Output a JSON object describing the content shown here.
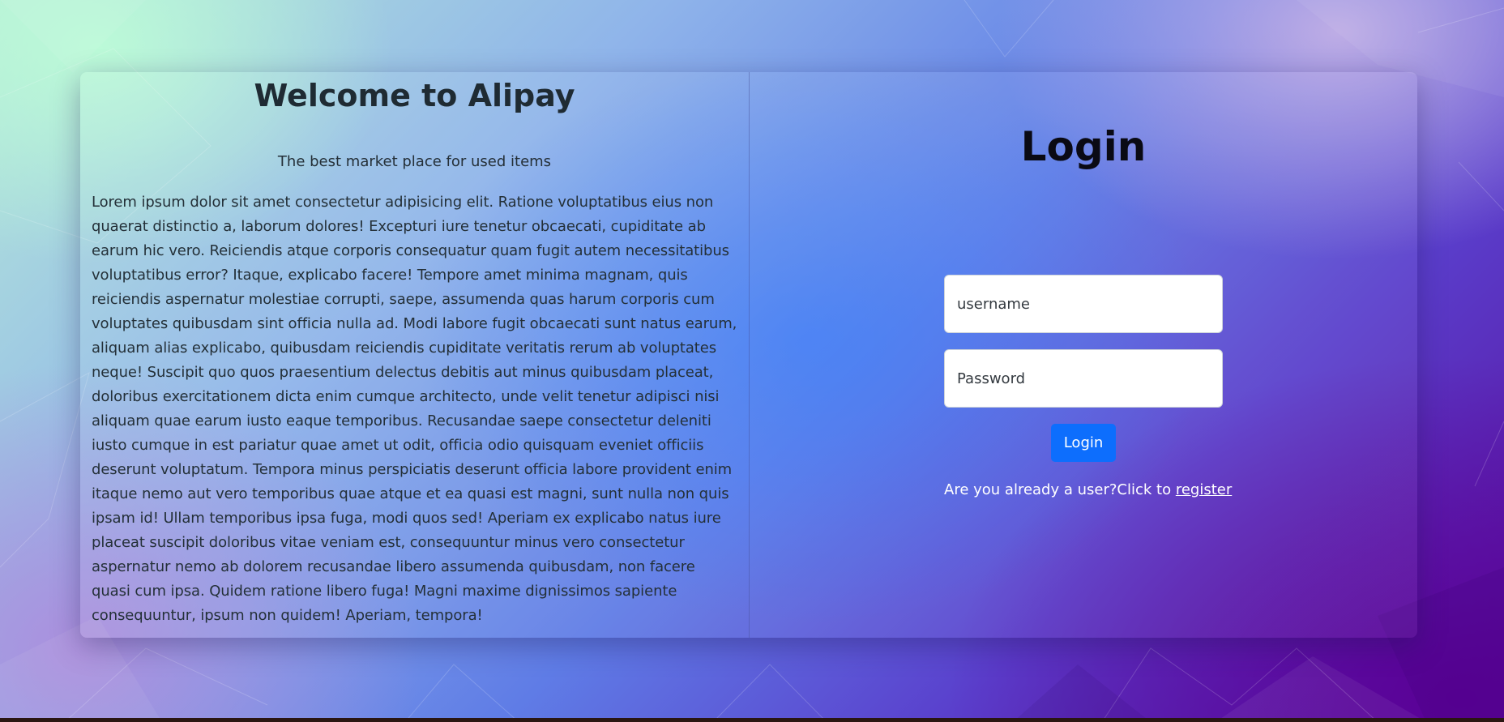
{
  "left": {
    "title": "Welcome to Alipay",
    "tagline": "The best market place for used items",
    "body": "Lorem ipsum dolor sit amet consectetur adipisicing elit. Ratione voluptatibus eius non quaerat distinctio a, laborum dolores! Excepturi iure tenetur obcaecati, cupiditate ab earum hic vero. Reiciendis atque corporis consequatur quam fugit autem necessitatibus voluptatibus error? Itaque, explicabo facere! Tempore amet minima magnam, quis reiciendis aspernatur molestiae corrupti, saepe, assumenda quas harum corporis cum voluptates quibusdam sint officia nulla ad. Modi labore fugit obcaecati sunt natus earum, aliquam alias explicabo, quibusdam reiciendis cupiditate veritatis rerum ab voluptates neque! Suscipit quo quos praesentium delectus debitis aut minus quibusdam placeat, doloribus exercitationem dicta enim cumque architecto, unde velit tenetur adipisci nisi aliquam quae earum iusto eaque temporibus. Recusandae saepe consectetur deleniti iusto cumque in est pariatur quae amet ut odit, officia odio quisquam eveniet officiis deserunt voluptatum. Tempora minus perspiciatis deserunt officia labore provident enim itaque nemo aut vero temporibus quae atque et ea quasi est magni, sunt nulla non quis ipsam id! Ullam temporibus ipsa fuga, modi quos sed! Aperiam ex explicabo natus iure placeat suscipit doloribus vitae veniam est, consequuntur minus vero consectetur aspernatur nemo ab dolorem recusandae libero assumenda quibusdam, non facere quasi cum ipsa. Quidem ratione libero fuga! Magni maxime dignissimos sapiente consequuntur, ipsum non quidem! Aperiam, tempora!"
  },
  "login": {
    "title": "Login",
    "username": {
      "placeholder": "username",
      "value": ""
    },
    "password": {
      "placeholder": "Password",
      "value": ""
    },
    "button_label": "Login",
    "register_prompt": "Are you already a user?Click to ",
    "register_link": "register"
  },
  "colors": {
    "button": "#0d6efd",
    "heading": "#1f2b33",
    "register_text": "#ffffff"
  }
}
